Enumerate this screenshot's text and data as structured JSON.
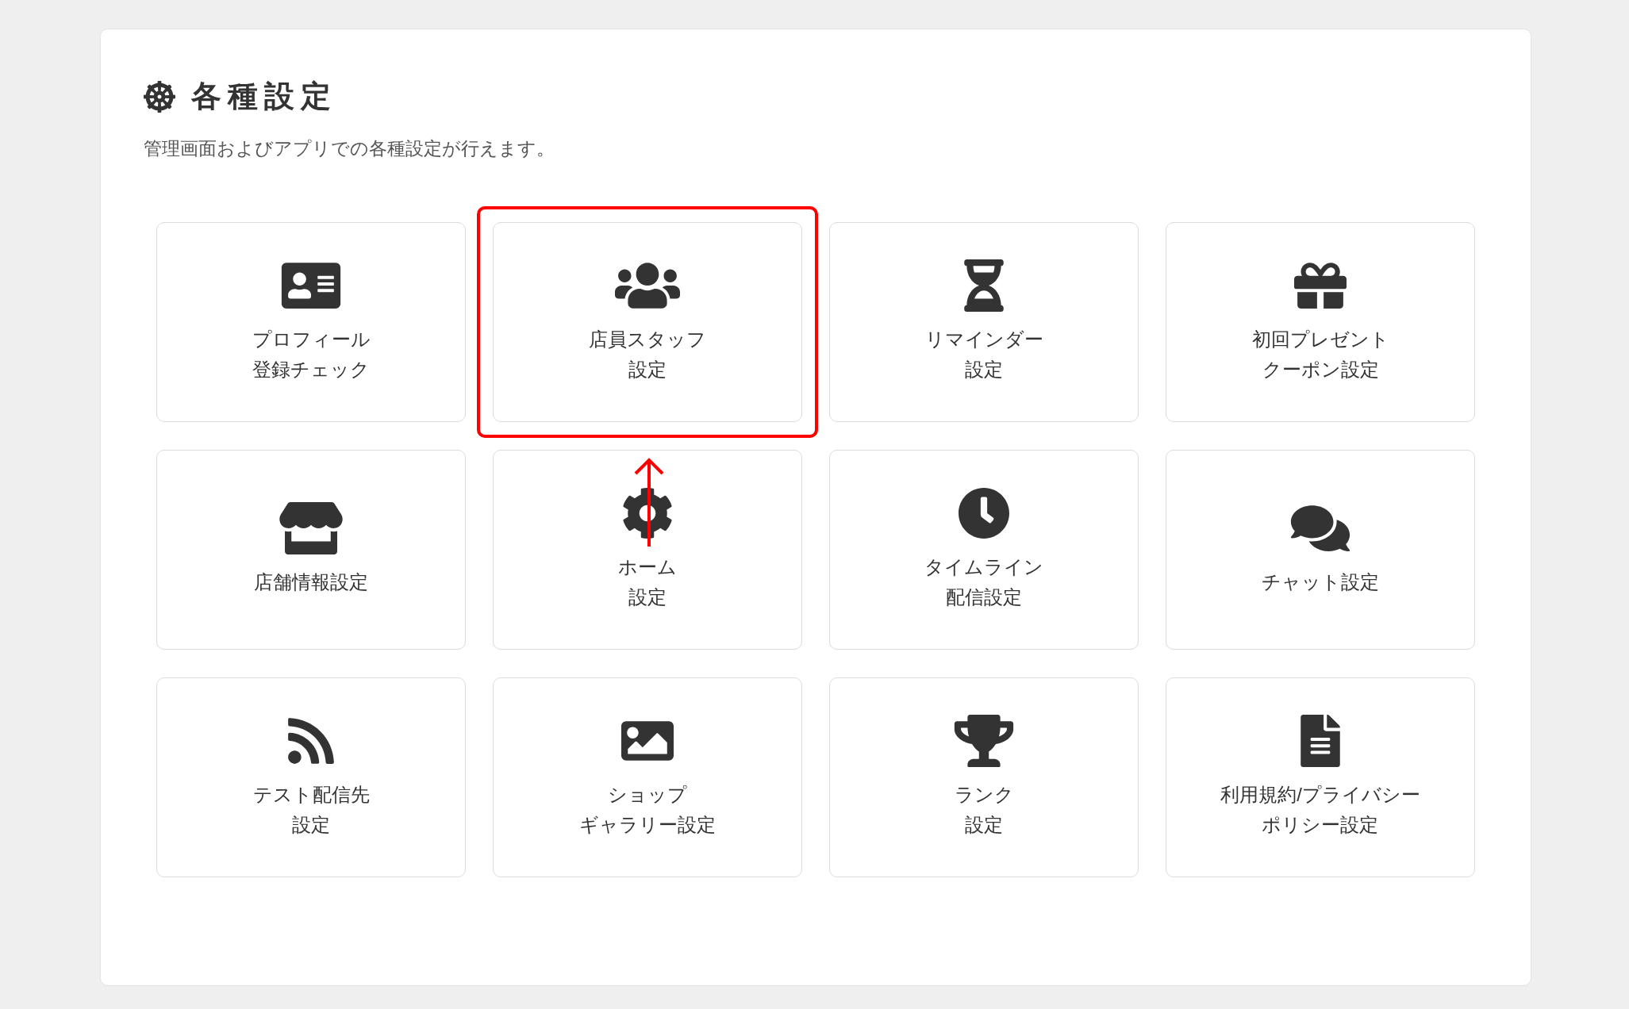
{
  "header": {
    "title": "各種設定",
    "description": "管理画面およびアプリでの各種設定が行えます。"
  },
  "tiles": [
    {
      "lines": [
        "プロフィール",
        "登録チェック"
      ],
      "highlighted": false
    },
    {
      "lines": [
        "店員スタッフ",
        "設定"
      ],
      "highlighted": true
    },
    {
      "lines": [
        "リマインダー",
        "設定"
      ],
      "highlighted": false
    },
    {
      "lines": [
        "初回プレゼント",
        "クーポン設定"
      ],
      "highlighted": false
    },
    {
      "lines": [
        "店舗情報設定"
      ],
      "highlighted": false
    },
    {
      "lines": [
        "ホーム",
        "設定"
      ],
      "highlighted": false
    },
    {
      "lines": [
        "タイムライン",
        "配信設定"
      ],
      "highlighted": false
    },
    {
      "lines": [
        "チャット設定"
      ],
      "highlighted": false
    },
    {
      "lines": [
        "テスト配信先",
        "設定"
      ],
      "highlighted": false
    },
    {
      "lines": [
        "ショップ",
        "ギャラリー設定"
      ],
      "highlighted": false
    },
    {
      "lines": [
        "ランク",
        "設定"
      ],
      "highlighted": false
    },
    {
      "lines": [
        "利用規約/プライバシー",
        "ポリシー設定"
      ],
      "highlighted": false
    }
  ]
}
